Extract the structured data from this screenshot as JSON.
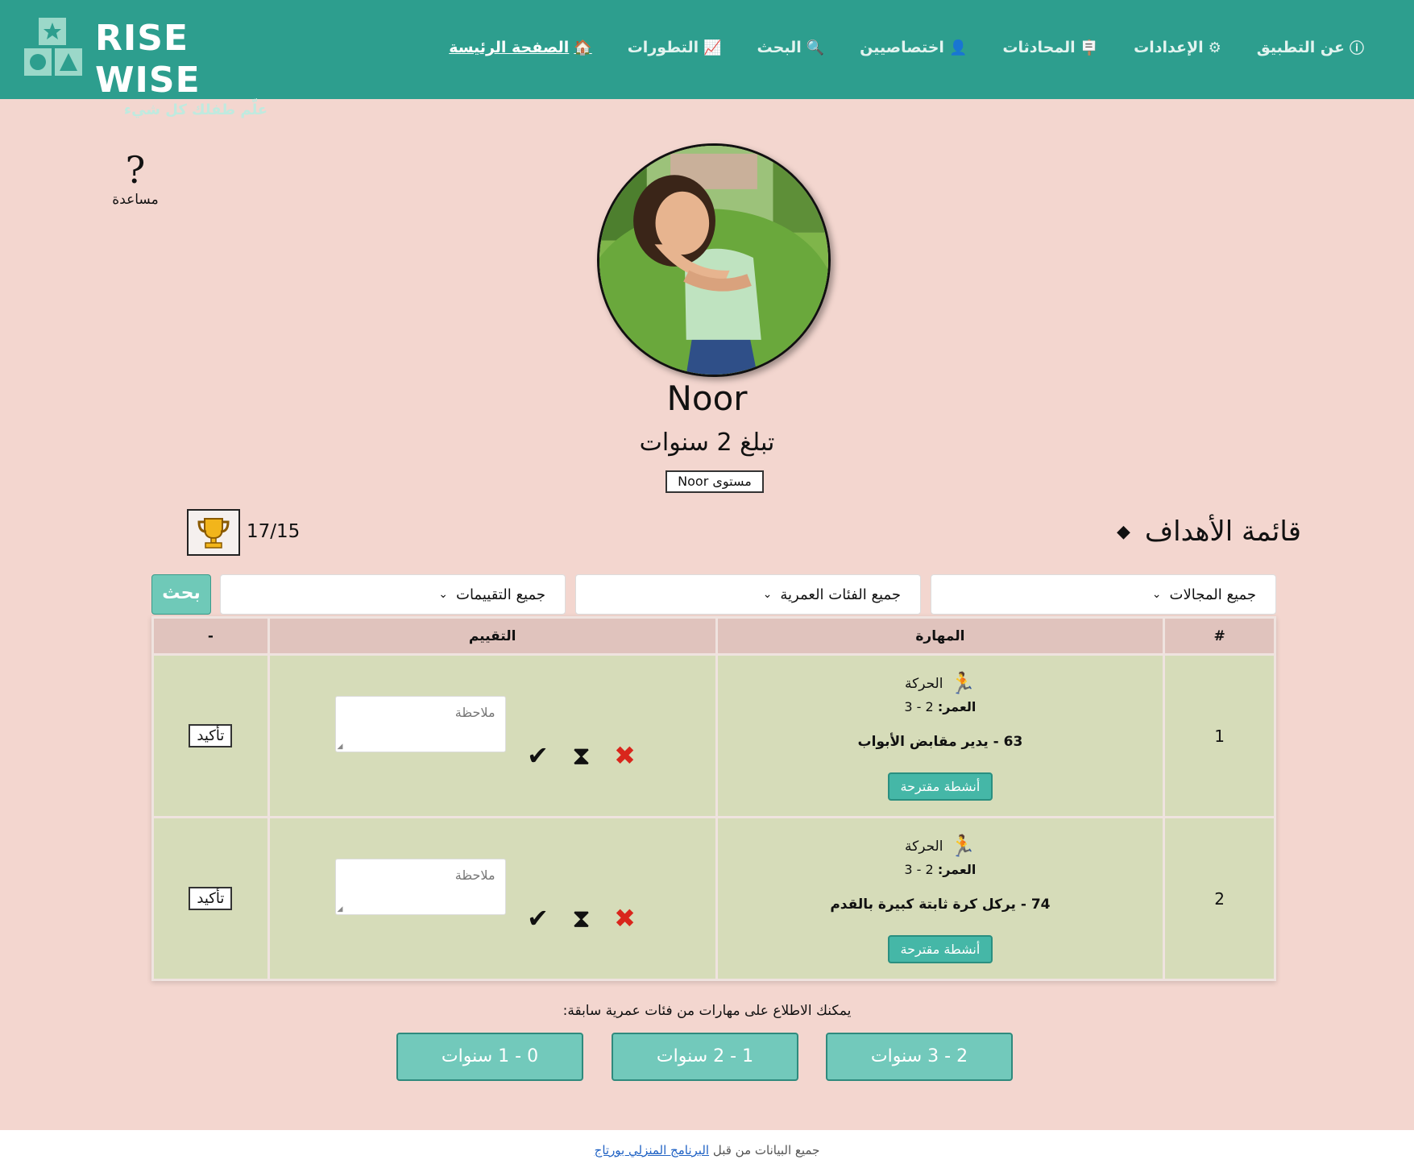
{
  "brand": {
    "name": "RISE WISE",
    "tagline": "علّم طفلك كل شيء"
  },
  "nav": [
    {
      "label": "الصفحة الرئيسة",
      "icon": "🏠",
      "active": true
    },
    {
      "label": "التطورات",
      "icon": "📈",
      "active": false
    },
    {
      "label": "البحث",
      "icon": "🔍",
      "active": false
    },
    {
      "label": "اختصاصيين",
      "icon": "👤",
      "active": false
    },
    {
      "label": "المحادثات",
      "icon": "🪧",
      "active": false
    },
    {
      "label": "الإعدادات",
      "icon": "⚙",
      "active": false
    },
    {
      "label": "عن التطبيق",
      "icon": "ⓘ",
      "active": false
    }
  ],
  "help": {
    "label": "مساعدة",
    "icon": "?"
  },
  "profile": {
    "name": "Noor",
    "age_text": "تبلغ 2 سنوات",
    "level_button": "مستوى Noor"
  },
  "goals": {
    "title": "قائمة الأهداف",
    "icon": "◆",
    "score": "17/15"
  },
  "filters": {
    "domains": "جميع المجالات",
    "ages": "جميع الفئات العمرية",
    "ratings": "جميع التقييمات",
    "search_button": "بحث"
  },
  "table": {
    "headers": {
      "num": "#",
      "skill": "المهارة",
      "rating": "التقييم",
      "action": "-"
    },
    "rows": [
      {
        "num": "1",
        "domain": "الحركة",
        "age_label": "العمر:",
        "age_value": "2 - 3",
        "skill": "63 - يدير مقابض الأبواب",
        "suggest": "أنشطة مقترحة",
        "note_placeholder": "ملاحظة",
        "confirm": "تأكيد"
      },
      {
        "num": "2",
        "domain": "الحركة",
        "age_label": "العمر:",
        "age_value": "2 - 3",
        "skill": "74 - يركل كرة ثابتة كبيرة بالقدم",
        "suggest": "أنشطة مقترحة",
        "note_placeholder": "ملاحظة",
        "confirm": "تأكيد"
      }
    ]
  },
  "previous": {
    "text": "يمكنك الاطلاع على مهارات من فئات عمرية سابقة:",
    "buttons": [
      "2 - 3 سنوات",
      "1 - 2 سنوات",
      "0 - 1 سنوات"
    ]
  },
  "footer": {
    "prefix": "جميع البيانات من قبل",
    "link": "البرنامج المنزلي بورتاج"
  },
  "colors": {
    "header": "#2d9e8e",
    "page_bg": "#f3d6cf",
    "accent": "#6fc9b8",
    "row_bg": "#d6dcb9",
    "header_row": "#e0c3bd"
  }
}
